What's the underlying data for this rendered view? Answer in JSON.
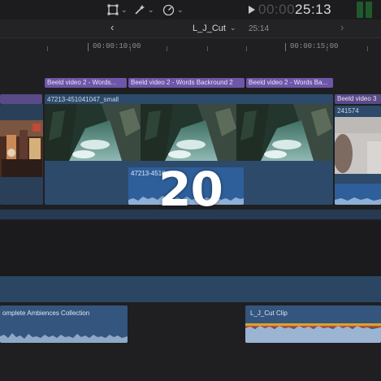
{
  "toolbar": {
    "tools": [
      {
        "icon": "transform-icon"
      },
      {
        "icon": "magic-wand-icon"
      },
      {
        "icon": "speed-gauge-icon"
      }
    ],
    "timecode_dim": "00:00",
    "timecode_bright": "25:13"
  },
  "project": {
    "name": "L_J_Cut",
    "duration": "25:14"
  },
  "ruler": {
    "labels": [
      "00:00:10:00",
      "00:00:15:00"
    ]
  },
  "titles": [
    "Beeld video 2 - Words...",
    "Beeld video 2 - Words Backround 2",
    "Beeld video 2 - Words Ba...",
    "Beeld video 3"
  ],
  "clips": {
    "main_video": "47213-451041047_small",
    "main_audio": "47213-4510",
    "right_video": "241574"
  },
  "bottom_clips": {
    "ambience": "omplete Ambiences Collection",
    "cut_clip": "L_J_Cut Clip"
  },
  "overlay": "20",
  "colors": {
    "title_clip": "#6e56a8",
    "video_clip": "#2d4a6b",
    "audio_clip": "#2f5f9b",
    "meter": "#1f5a2b"
  }
}
